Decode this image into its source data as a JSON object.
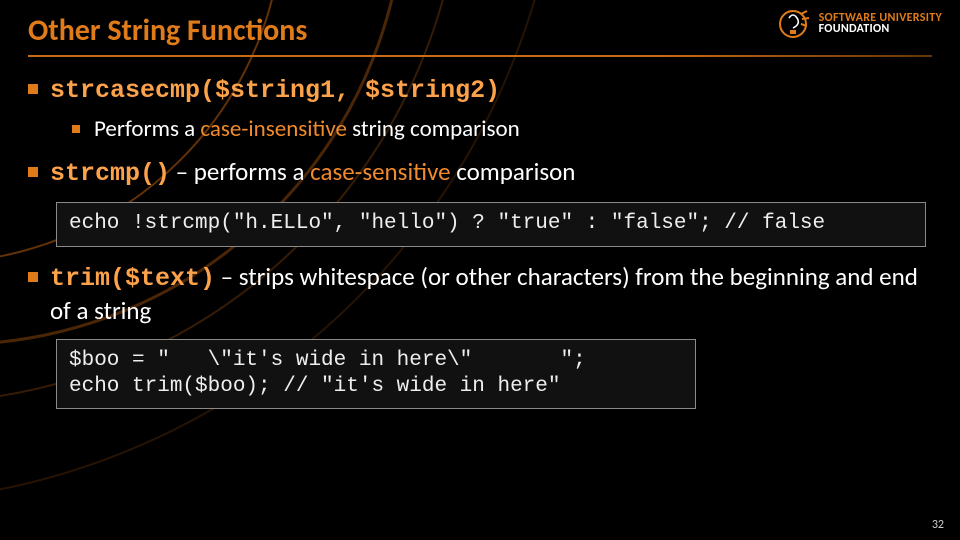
{
  "title": "Other String Functions",
  "logo": {
    "line1": "SOFTWARE UNIVERSITY",
    "line2": "FOUNDATION"
  },
  "bullets": {
    "b1_code": "strcasecmp($string1, $string2)",
    "b1_sub_pre": "Performs a ",
    "b1_sub_hl": "case-insensitive",
    "b1_sub_post": " string comparison",
    "b2_code": "strcmp()",
    "b2_text_pre": " – performs a ",
    "b2_text_hl": "case-sensitive",
    "b2_text_post": " comparison",
    "b3_code": "trim($text)",
    "b3_text": " – strips whitespace (or other characters) from the beginning and end of a string"
  },
  "code1": "echo !strcmp(\"h.ELLo\", \"hello\") ? \"true\" : \"false\"; // false",
  "code2": "$boo = \"   \\\"it's wide in here\\\"       \";\necho trim($boo); // \"it's wide in here\"",
  "page_number": "32"
}
